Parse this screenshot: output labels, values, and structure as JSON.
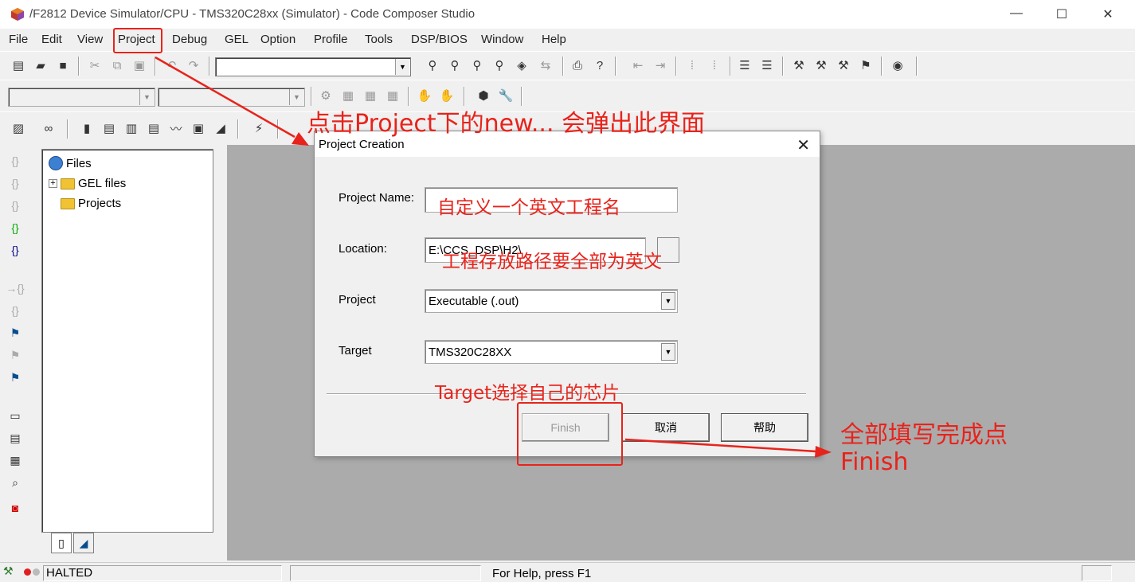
{
  "window": {
    "title": "/F2812 Device Simulator/CPU - TMS320C28xx (Simulator) - Code Composer Studio",
    "controls": [
      "—",
      "☐",
      "✕"
    ]
  },
  "menubar": [
    "File",
    "Edit",
    "View",
    "Project",
    "Debug",
    "GEL",
    "Option",
    "Profile",
    "Tools",
    "DSP/BIOS",
    "Window",
    "Help"
  ],
  "project_pane": {
    "root_label": "Files",
    "items": [
      "GEL files",
      "Projects"
    ]
  },
  "dialog": {
    "title": "Project Creation",
    "close": "✕",
    "project_name_label": "Project Name:",
    "project_name_value": "",
    "location_label": "Location:",
    "location_value": "E:\\CCS_DSP\\H2\\",
    "project_label": "Project",
    "project_value": "Executable (.out)",
    "target_label": "Target",
    "target_value": "TMS320C28XX",
    "buttons": {
      "finish": "Finish",
      "cancel": "取消",
      "help": "帮助"
    }
  },
  "statusbar": {
    "state": "HALTED",
    "help": "For Help, press F1"
  },
  "annotations": {
    "top": "点击Project下的new... 会弹出此界面",
    "name_hint": "自定义一个英文工程名",
    "location_hint": "工程存放路径要全部为英文",
    "target_hint": "Target选择自己的芯片",
    "finish_hint_1": "全部填写完成点",
    "finish_hint_2": "Finish",
    "accent_color": "#e8231b"
  }
}
